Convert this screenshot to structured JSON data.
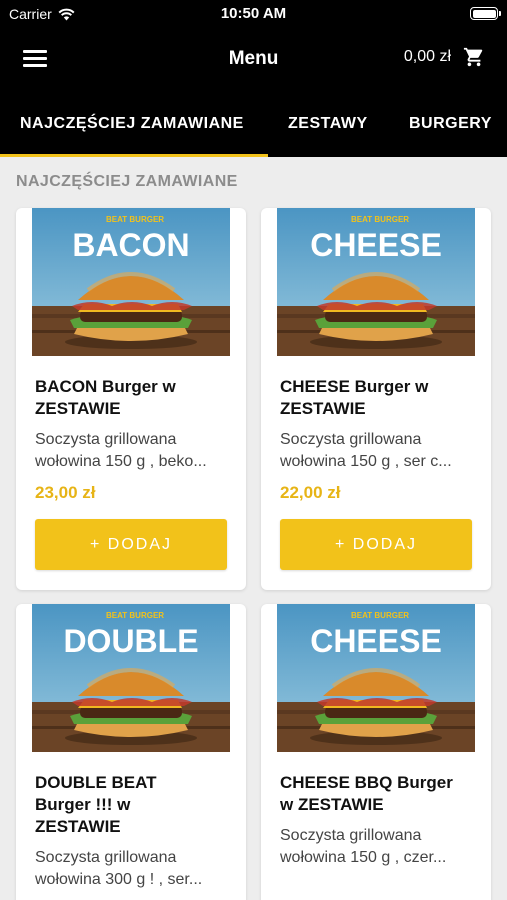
{
  "status_bar": {
    "carrier": "Carrier",
    "time": "10:50 AM"
  },
  "nav": {
    "title": "Menu",
    "cart_amount": "0,00 zł"
  },
  "tabs": [
    "NAJCZĘŚCIEJ ZAMAWIANE",
    "ZESTAWY",
    "BURGERY"
  ],
  "section_title": "NAJCZĘŚCIEJ ZAMAWIANE",
  "colors": {
    "accent": "#f2c21a",
    "price": "#e7b416",
    "header_bg": "#000000",
    "page_bg": "#ededed"
  },
  "products": [
    {
      "photo_word": "BACON",
      "brand": "BEAT BURGER",
      "name_line1": "BACON Burger w",
      "name_line2": "ZESTAWIE",
      "name_line3": "",
      "desc_line1": "Soczysta grillowana",
      "desc_line2": "wołowina 150 g , beko...",
      "price": "23,00 zł",
      "button": "+ DODAJ"
    },
    {
      "photo_word": "CHEESE",
      "brand": "BEAT BURGER",
      "name_line1": "CHEESE Burger w",
      "name_line2": "ZESTAWIE",
      "name_line3": "",
      "desc_line1": "Soczysta grillowana",
      "desc_line2": "wołowina 150 g , ser c...",
      "price": "22,00 zł",
      "button": "+ DODAJ"
    },
    {
      "photo_word": "DOUBLE",
      "brand": "BEAT BURGER",
      "name_line1": "DOUBLE BEAT",
      "name_line2": "Burger !!! w",
      "name_line3": "ZESTAWIE",
      "desc_line1": "Soczysta grillowana",
      "desc_line2": "wołowina 300 g ! , ser...",
      "price": "",
      "button": ""
    },
    {
      "photo_word": "CHEESE",
      "brand": "BEAT BURGER",
      "name_line1": "CHEESE BBQ Burger",
      "name_line2": "w ZESTAWIE",
      "name_line3": "",
      "desc_line1": "Soczysta grillowana",
      "desc_line2": "wołowina 150 g , czer...",
      "price": "",
      "button": ""
    }
  ]
}
